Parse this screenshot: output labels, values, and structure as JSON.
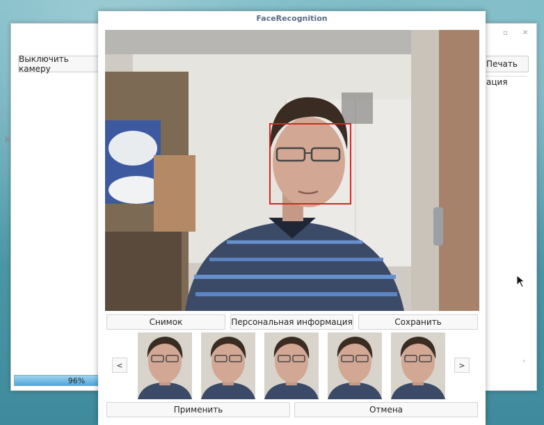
{
  "background_window": {
    "left_button": "Выключить камеру",
    "right_button": "Печать",
    "right_label": "ация",
    "left_fragment": "К",
    "right_fragment": "›",
    "progress": {
      "value": 0.96,
      "label": "96%"
    }
  },
  "dialog": {
    "title": "FaceRecognition",
    "face_box_color": "#e02020",
    "actions": {
      "snapshot": "Снимок",
      "personal_info": "Персональная информация",
      "save": "Сохранить"
    },
    "gallery": {
      "prev_label": "<",
      "next_label": ">",
      "thumbnail_count": 5
    },
    "apply": "Применить",
    "cancel": "Отмена"
  },
  "colors": {
    "accent": "#4fa6da",
    "desktop": "#4d98a8"
  }
}
